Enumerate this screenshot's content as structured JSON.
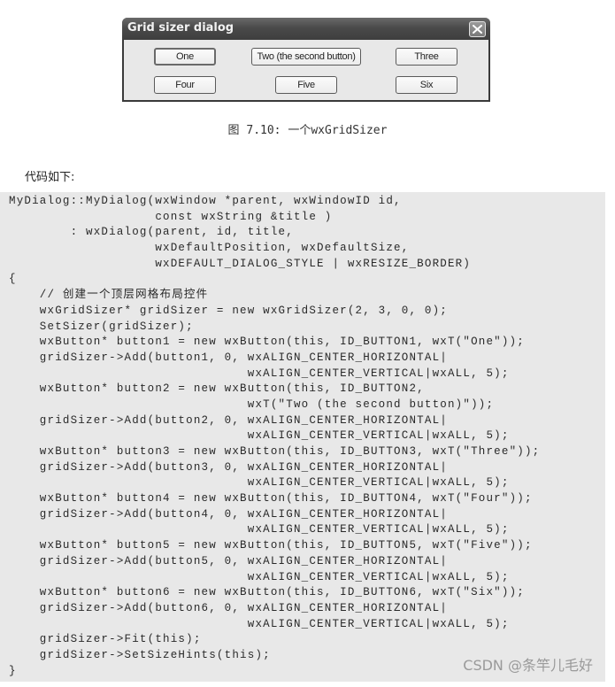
{
  "dialog": {
    "title": "Grid sizer dialog",
    "close_icon": "close-x-icon",
    "buttons": [
      {
        "label": "One",
        "is_default": true
      },
      {
        "label": "Two (the second button)",
        "is_default": false
      },
      {
        "label": "Three",
        "is_default": false
      },
      {
        "label": "Four",
        "is_default": false
      },
      {
        "label": "Five",
        "is_default": false
      },
      {
        "label": "Six",
        "is_default": false
      }
    ]
  },
  "caption": "图 7.10: 一个wxGridSizer",
  "intro": "代码如下:",
  "code": {
    "lines": [
      "MyDialog::MyDialog(wxWindow *parent, wxWindowID id,",
      "                   const wxString &title )",
      "        : wxDialog(parent, id, title,",
      "                   wxDefaultPosition, wxDefaultSize,",
      "                   wxDEFAULT_DIALOG_STYLE | wxRESIZE_BORDER)",
      "{",
      "    // 创建一个顶层网格布局控件",
      "    wxGridSizer* gridSizer = new wxGridSizer(2, 3, 0, 0);",
      "    SetSizer(gridSizer);",
      "    wxButton* button1 = new wxButton(this, ID_BUTTON1, wxT(\"One\"));",
      "    gridSizer->Add(button1, 0, wxALIGN_CENTER_HORIZONTAL|",
      "                               wxALIGN_CENTER_VERTICAL|wxALL, 5);",
      "    wxButton* button2 = new wxButton(this, ID_BUTTON2,",
      "                               wxT(\"Two (the second button)\"));",
      "    gridSizer->Add(button2, 0, wxALIGN_CENTER_HORIZONTAL|",
      "                               wxALIGN_CENTER_VERTICAL|wxALL, 5);",
      "    wxButton* button3 = new wxButton(this, ID_BUTTON3, wxT(\"Three\"));",
      "    gridSizer->Add(button3, 0, wxALIGN_CENTER_HORIZONTAL|",
      "                               wxALIGN_CENTER_VERTICAL|wxALL, 5);",
      "    wxButton* button4 = new wxButton(this, ID_BUTTON4, wxT(\"Four\"));",
      "    gridSizer->Add(button4, 0, wxALIGN_CENTER_HORIZONTAL|",
      "                               wxALIGN_CENTER_VERTICAL|wxALL, 5);",
      "    wxButton* button5 = new wxButton(this, ID_BUTTON5, wxT(\"Five\"));",
      "    gridSizer->Add(button5, 0, wxALIGN_CENTER_HORIZONTAL|",
      "                               wxALIGN_CENTER_VERTICAL|wxALL, 5);",
      "    wxButton* button6 = new wxButton(this, ID_BUTTON6, wxT(\"Six\"));",
      "    gridSizer->Add(button6, 0, wxALIGN_CENTER_HORIZONTAL|",
      "                               wxALIGN_CENTER_VERTICAL|wxALL, 5);",
      "    gridSizer->Fit(this);",
      "    gridSizer->SetSizeHints(this);",
      "}"
    ]
  },
  "watermark": "CSDN @条竿儿毛好"
}
